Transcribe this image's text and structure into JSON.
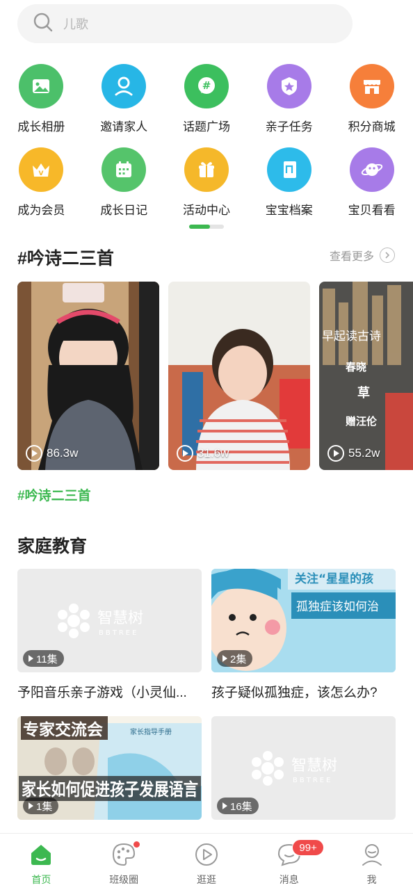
{
  "search": {
    "placeholder": "儿歌"
  },
  "quick_menu": [
    {
      "label": "成长相册",
      "icon": "photo-album-icon",
      "color": "#4cc06a"
    },
    {
      "label": "邀请家人",
      "icon": "invite-family-icon",
      "color": "#27b6e6"
    },
    {
      "label": "话题广场",
      "icon": "hashtag-topic-icon",
      "color": "#3cbf5e"
    },
    {
      "label": "亲子任务",
      "icon": "task-badge-icon",
      "color": "#a77be8"
    },
    {
      "label": "积分商城",
      "icon": "store-icon",
      "color": "#f67f3a"
    },
    {
      "label": "成为会员",
      "icon": "vip-crown-icon",
      "color": "#f7b829"
    },
    {
      "label": "成长日记",
      "icon": "calendar-diary-icon",
      "color": "#55c46b"
    },
    {
      "label": "活动中心",
      "icon": "gift-activity-icon",
      "color": "#f5b82a"
    },
    {
      "label": "宝宝档案",
      "icon": "baby-file-icon",
      "color": "#2dbbea"
    },
    {
      "label": "宝贝看看",
      "icon": "planet-watch-icon",
      "color": "#a77be8"
    }
  ],
  "poetry_section": {
    "title": "#吟诗二三首",
    "more_label": "查看更多",
    "videos": [
      {
        "views": "86.3w"
      },
      {
        "views": "31.6w"
      },
      {
        "views": "55.2w",
        "overlay_text": [
          "早起读古诗",
          "春晓",
          "草",
          "赠汪伦"
        ]
      }
    ],
    "tag": "#吟诗二三首"
  },
  "family_section": {
    "title": "家庭教育",
    "cards": [
      {
        "episodes": "11集",
        "title": "予阳音乐亲子游戏（小灵仙...",
        "logo_cn": "智慧树",
        "logo_en": "BBTREE"
      },
      {
        "episodes": "2集",
        "title": "孩子疑似孤独症，该怎么办?",
        "thumb_text": [
          "关注“星星的孩",
          "孤独症该如何治"
        ]
      },
      {
        "episodes": "1集",
        "title": "",
        "thumb_text": [
          "专家交流会",
          "家长如何促进孩子发展语言",
          "家长指导手册"
        ]
      },
      {
        "episodes": "16集",
        "title": "",
        "logo_cn": "智慧树",
        "logo_en": "BBTREE"
      }
    ]
  },
  "tabbar": [
    {
      "label": "首页",
      "icon": "home-icon",
      "active": true
    },
    {
      "label": "班级圈",
      "icon": "palette-icon",
      "dot": true
    },
    {
      "label": "逛逛",
      "icon": "play-circle-icon"
    },
    {
      "label": "消息",
      "icon": "message-icon",
      "badge": "99+"
    },
    {
      "label": "我",
      "icon": "profile-icon"
    }
  ],
  "colors": {
    "accent": "#3cb850",
    "badge": "#f04a4a"
  }
}
